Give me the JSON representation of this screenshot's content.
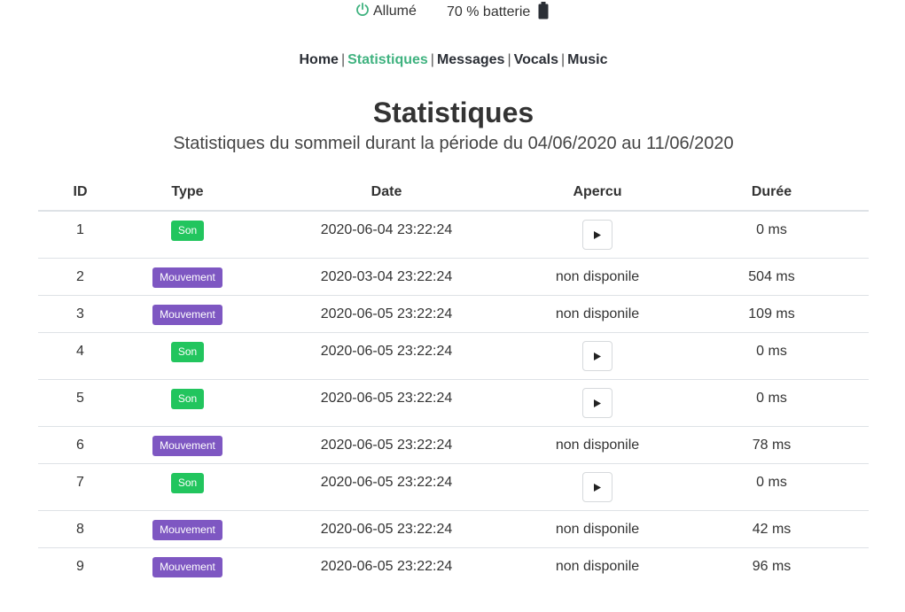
{
  "status": {
    "power_label": "Allumé",
    "battery_label": "70 % batterie",
    "power_color": "#3fb27f"
  },
  "nav": {
    "items": [
      {
        "label": "Home",
        "active": false
      },
      {
        "label": "Statistiques",
        "active": true
      },
      {
        "label": "Messages",
        "active": false
      },
      {
        "label": "Vocals",
        "active": false
      },
      {
        "label": "Music",
        "active": false
      }
    ],
    "separator": "|"
  },
  "page": {
    "title": "Statistiques",
    "subtitle": "Statistiques du sommeil durant la période du 04/06/2020 au 11/06/2020"
  },
  "table": {
    "headers": [
      "ID",
      "Type",
      "Date",
      "Apercu",
      "Durée"
    ],
    "rows": [
      {
        "id": "1",
        "type": "Son",
        "date": "2020-06-04 23:22:24",
        "apercu": "play",
        "duree": "0 ms"
      },
      {
        "id": "2",
        "type": "Mouvement",
        "date": "2020-03-04 23:22:24",
        "apercu": "non disponile",
        "duree": "504 ms"
      },
      {
        "id": "3",
        "type": "Mouvement",
        "date": "2020-06-05 23:22:24",
        "apercu": "non disponile",
        "duree": "109 ms"
      },
      {
        "id": "4",
        "type": "Son",
        "date": "2020-06-05 23:22:24",
        "apercu": "play",
        "duree": "0 ms"
      },
      {
        "id": "5",
        "type": "Son",
        "date": "2020-06-05 23:22:24",
        "apercu": "play",
        "duree": "0 ms"
      },
      {
        "id": "6",
        "type": "Mouvement",
        "date": "2020-06-05 23:22:24",
        "apercu": "non disponile",
        "duree": "78 ms"
      },
      {
        "id": "7",
        "type": "Son",
        "date": "2020-06-05 23:22:24",
        "apercu": "play",
        "duree": "0 ms"
      },
      {
        "id": "8",
        "type": "Mouvement",
        "date": "2020-06-05 23:22:24",
        "apercu": "non disponile",
        "duree": "42 ms"
      },
      {
        "id": "9",
        "type": "Mouvement",
        "date": "2020-06-05 23:22:24",
        "apercu": "non disponile",
        "duree": "96 ms"
      }
    ]
  },
  "colors": {
    "son_badge": "#22c55e",
    "mouvement_badge": "#7e57c2",
    "nav_active": "#3fb27f"
  },
  "icons": {
    "power": "power-icon",
    "battery": "battery-icon",
    "play": "play-icon"
  }
}
